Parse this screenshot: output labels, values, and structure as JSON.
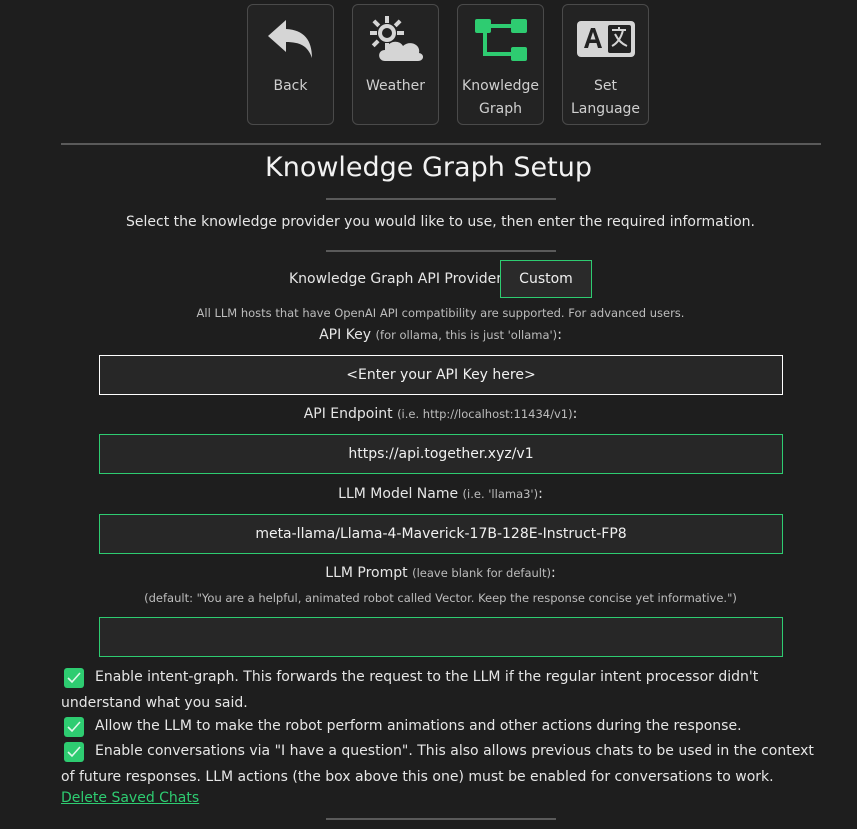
{
  "nav": {
    "tiles": [
      {
        "label": "Back",
        "icon": "back-arrow-icon"
      },
      {
        "label": "Weather",
        "icon": "weather-icon"
      },
      {
        "label": "Knowledge\nGraph",
        "icon": "knowledge-graph-icon"
      },
      {
        "label": "Set\nLanguage",
        "icon": "language-icon"
      }
    ]
  },
  "title": "Knowledge Graph Setup",
  "description": "Select the knowledge provider you would like to use, then enter the required information.",
  "provider": {
    "label": "Knowledge Graph API Provider:",
    "selected": "Custom",
    "note": "All LLM hosts that have OpenAI API compatibility are supported. For advanced users."
  },
  "fields": {
    "api_key": {
      "label": "API Key",
      "hint": "(for ollama, this is just 'ollama')",
      "colon": ":",
      "value": "<Enter your API Key here>"
    },
    "endpoint": {
      "label": "API Endpoint",
      "hint": "(i.e. http://localhost:11434/v1)",
      "colon": ":",
      "value": "https://api.together.xyz/v1"
    },
    "model": {
      "label": "LLM Model Name",
      "hint": "(i.e. 'llama3')",
      "colon": ":",
      "value": "meta-llama/Llama-4-Maverick-17B-128E-Instruct-FP8"
    },
    "prompt": {
      "label": "LLM Prompt",
      "hint": "(leave blank for default)",
      "colon": ":",
      "default_note": "(default: \"You are a helpful, animated robot called Vector. Keep the response concise yet informative.\")",
      "value": ""
    }
  },
  "options": [
    {
      "checked": true,
      "text": "Enable intent-graph. This forwards the request to the LLM if the regular intent processor didn't understand what you said."
    },
    {
      "checked": true,
      "text": "Allow the LLM to make the robot perform animations and other actions during the response."
    },
    {
      "checked": true,
      "text": "Enable conversations via \"I have a question\". This also allows previous chats to be used in the context of future responses. LLM actions (the box above this one) must be enabled for conversations to work."
    }
  ],
  "delete_link": "Delete Saved Chats",
  "colors": {
    "accent": "#2ecc71",
    "background": "#1e1e1e"
  }
}
